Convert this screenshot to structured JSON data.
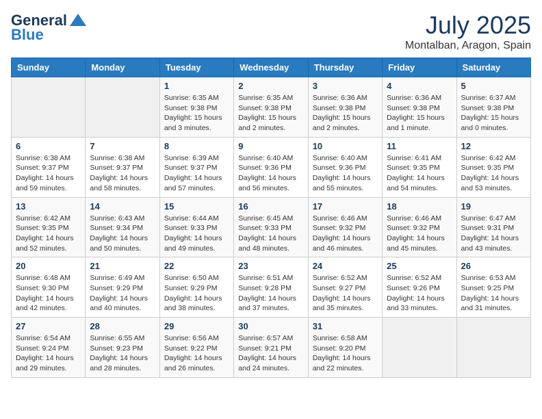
{
  "header": {
    "logo_line1": "General",
    "logo_line2": "Blue",
    "month_title": "July 2025",
    "location": "Montalban, Aragon, Spain"
  },
  "weekdays": [
    "Sunday",
    "Monday",
    "Tuesday",
    "Wednesday",
    "Thursday",
    "Friday",
    "Saturday"
  ],
  "weeks": [
    [
      {
        "day": "",
        "info": ""
      },
      {
        "day": "",
        "info": ""
      },
      {
        "day": "1",
        "info": "Sunrise: 6:35 AM\nSunset: 9:38 PM\nDaylight: 15 hours and 3 minutes."
      },
      {
        "day": "2",
        "info": "Sunrise: 6:35 AM\nSunset: 9:38 PM\nDaylight: 15 hours and 2 minutes."
      },
      {
        "day": "3",
        "info": "Sunrise: 6:36 AM\nSunset: 9:38 PM\nDaylight: 15 hours and 2 minutes."
      },
      {
        "day": "4",
        "info": "Sunrise: 6:36 AM\nSunset: 9:38 PM\nDaylight: 15 hours and 1 minute."
      },
      {
        "day": "5",
        "info": "Sunrise: 6:37 AM\nSunset: 9:38 PM\nDaylight: 15 hours and 0 minutes."
      }
    ],
    [
      {
        "day": "6",
        "info": "Sunrise: 6:38 AM\nSunset: 9:37 PM\nDaylight: 14 hours and 59 minutes."
      },
      {
        "day": "7",
        "info": "Sunrise: 6:38 AM\nSunset: 9:37 PM\nDaylight: 14 hours and 58 minutes."
      },
      {
        "day": "8",
        "info": "Sunrise: 6:39 AM\nSunset: 9:37 PM\nDaylight: 14 hours and 57 minutes."
      },
      {
        "day": "9",
        "info": "Sunrise: 6:40 AM\nSunset: 9:36 PM\nDaylight: 14 hours and 56 minutes."
      },
      {
        "day": "10",
        "info": "Sunrise: 6:40 AM\nSunset: 9:36 PM\nDaylight: 14 hours and 55 minutes."
      },
      {
        "day": "11",
        "info": "Sunrise: 6:41 AM\nSunset: 9:35 PM\nDaylight: 14 hours and 54 minutes."
      },
      {
        "day": "12",
        "info": "Sunrise: 6:42 AM\nSunset: 9:35 PM\nDaylight: 14 hours and 53 minutes."
      }
    ],
    [
      {
        "day": "13",
        "info": "Sunrise: 6:42 AM\nSunset: 9:35 PM\nDaylight: 14 hours and 52 minutes."
      },
      {
        "day": "14",
        "info": "Sunrise: 6:43 AM\nSunset: 9:34 PM\nDaylight: 14 hours and 50 minutes."
      },
      {
        "day": "15",
        "info": "Sunrise: 6:44 AM\nSunset: 9:33 PM\nDaylight: 14 hours and 49 minutes."
      },
      {
        "day": "16",
        "info": "Sunrise: 6:45 AM\nSunset: 9:33 PM\nDaylight: 14 hours and 48 minutes."
      },
      {
        "day": "17",
        "info": "Sunrise: 6:46 AM\nSunset: 9:32 PM\nDaylight: 14 hours and 46 minutes."
      },
      {
        "day": "18",
        "info": "Sunrise: 6:46 AM\nSunset: 9:32 PM\nDaylight: 14 hours and 45 minutes."
      },
      {
        "day": "19",
        "info": "Sunrise: 6:47 AM\nSunset: 9:31 PM\nDaylight: 14 hours and 43 minutes."
      }
    ],
    [
      {
        "day": "20",
        "info": "Sunrise: 6:48 AM\nSunset: 9:30 PM\nDaylight: 14 hours and 42 minutes."
      },
      {
        "day": "21",
        "info": "Sunrise: 6:49 AM\nSunset: 9:29 PM\nDaylight: 14 hours and 40 minutes."
      },
      {
        "day": "22",
        "info": "Sunrise: 6:50 AM\nSunset: 9:29 PM\nDaylight: 14 hours and 38 minutes."
      },
      {
        "day": "23",
        "info": "Sunrise: 6:51 AM\nSunset: 9:28 PM\nDaylight: 14 hours and 37 minutes."
      },
      {
        "day": "24",
        "info": "Sunrise: 6:52 AM\nSunset: 9:27 PM\nDaylight: 14 hours and 35 minutes."
      },
      {
        "day": "25",
        "info": "Sunrise: 6:52 AM\nSunset: 9:26 PM\nDaylight: 14 hours and 33 minutes."
      },
      {
        "day": "26",
        "info": "Sunrise: 6:53 AM\nSunset: 9:25 PM\nDaylight: 14 hours and 31 minutes."
      }
    ],
    [
      {
        "day": "27",
        "info": "Sunrise: 6:54 AM\nSunset: 9:24 PM\nDaylight: 14 hours and 29 minutes."
      },
      {
        "day": "28",
        "info": "Sunrise: 6:55 AM\nSunset: 9:23 PM\nDaylight: 14 hours and 28 minutes."
      },
      {
        "day": "29",
        "info": "Sunrise: 6:56 AM\nSunset: 9:22 PM\nDaylight: 14 hours and 26 minutes."
      },
      {
        "day": "30",
        "info": "Sunrise: 6:57 AM\nSunset: 9:21 PM\nDaylight: 14 hours and 24 minutes."
      },
      {
        "day": "31",
        "info": "Sunrise: 6:58 AM\nSunset: 9:20 PM\nDaylight: 14 hours and 22 minutes."
      },
      {
        "day": "",
        "info": ""
      },
      {
        "day": "",
        "info": ""
      }
    ]
  ]
}
